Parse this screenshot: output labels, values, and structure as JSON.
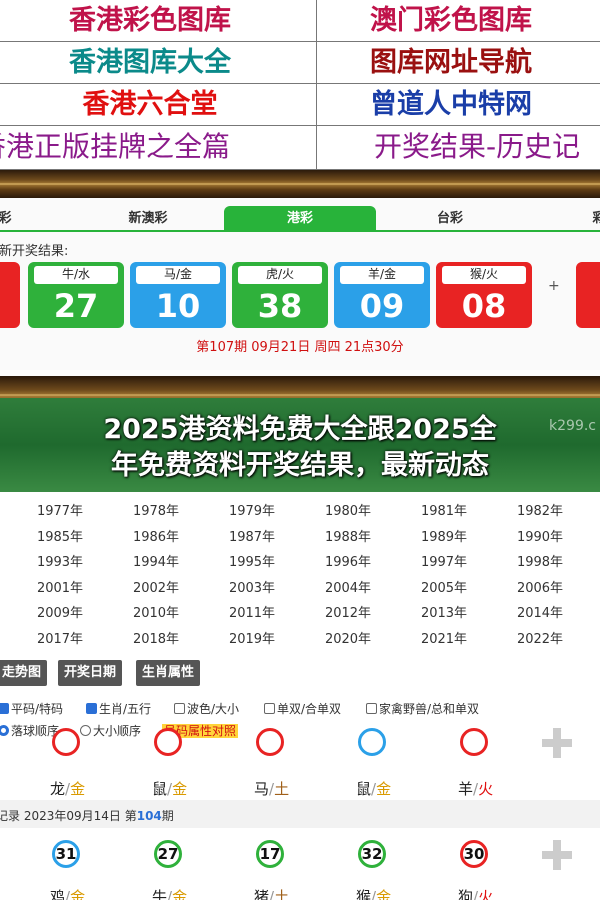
{
  "links": {
    "rows": [
      {
        "left": "香港彩色图库",
        "right": "澳门彩色图库",
        "left_color": "#c0134a",
        "right_color": "#c0134a"
      },
      {
        "left": "香港图库大全",
        "right": "图库网址导航",
        "left_color": "#0b8a8a",
        "right_color": "#9a1010"
      },
      {
        "left": "香港六合堂",
        "right": "曾道人中特网",
        "left_color": "#e01010",
        "right_color": "#1a3ea8"
      },
      {
        "left": "香港正版挂牌之全篇",
        "right": "开奖结果-历史记",
        "left_color": "#8a1a8a",
        "right_color": "#8a1a8a"
      }
    ]
  },
  "tabs": [
    "彩",
    "新澳彩",
    "港彩",
    "台彩",
    "彩"
  ],
  "active_tab": 2,
  "latest_label": "最新开奖结果:",
  "balls": [
    {
      "zodiac": "牛/水",
      "number": "27",
      "color": "#2fb13b"
    },
    {
      "zodiac": "马/金",
      "number": "10",
      "color": "#2ba0e8"
    },
    {
      "zodiac": "虎/火",
      "number": "38",
      "color": "#2fb13b"
    },
    {
      "zodiac": "羊/金",
      "number": "09",
      "color": "#2ba0e8"
    },
    {
      "zodiac": "猴/火",
      "number": "08",
      "color": "#e82323"
    }
  ],
  "plus": "+",
  "draw_info": "第107期 09月21日 周四 21点30分",
  "banner": {
    "line1": "2025港资料免费大全跟2025全",
    "line2": "年免费资料开奖结果，最新动态",
    "watermark": "k299.c"
  },
  "years": [
    [
      "1977年",
      "1978年",
      "1979年",
      "1980年",
      "1981年",
      "1982年"
    ],
    [
      "1985年",
      "1986年",
      "1987年",
      "1988年",
      "1989年",
      "1990年"
    ],
    [
      "1993年",
      "1994年",
      "1995年",
      "1996年",
      "1997年",
      "1998年"
    ],
    [
      "2001年",
      "2002年",
      "2003年",
      "2004年",
      "2005年",
      "2006年"
    ],
    [
      "2009年",
      "2010年",
      "2011年",
      "2012年",
      "2013年",
      "2014年"
    ],
    [
      "2017年",
      "2018年",
      "2019年",
      "2020年",
      "2021年",
      "2022年"
    ]
  ],
  "buttons": [
    "走势图",
    "开奖日期",
    "生肖属性"
  ],
  "filters": {
    "row1": [
      {
        "label": "平码/特码",
        "checked": true
      },
      {
        "label": "生肖/五行",
        "checked": true
      },
      {
        "label": "波色/大小",
        "checked": false
      },
      {
        "label": "单双/合单双",
        "checked": false
      },
      {
        "label": "家禽野兽/总和单双",
        "checked": false
      }
    ],
    "row2": [
      {
        "label": "落球顺序",
        "checked": true
      },
      {
        "label": "大小顺序",
        "checked": false
      }
    ],
    "highlight": "号码属性对照"
  },
  "history": {
    "row1_zodiac": [
      {
        "z": "龙",
        "e": "金",
        "ec": "#d99a00"
      },
      {
        "z": "鼠",
        "e": "金",
        "ec": "#d99a00"
      },
      {
        "z": "马",
        "e": "土",
        "ec": "#a0601a"
      },
      {
        "z": "鼠",
        "e": "金",
        "ec": "#d99a00"
      },
      {
        "z": "羊",
        "e": "火",
        "ec": "#e01010"
      }
    ],
    "row1_colors": [
      "#e82323",
      "#e82323",
      "#e82323",
      "#2ba0e8",
      "#e82323"
    ],
    "record_prefix": "记录 2023年09月14日 第",
    "record_issue": "104",
    "record_suffix": "期",
    "row2_balls": [
      {
        "n": "31",
        "c": "#2ba0e8"
      },
      {
        "n": "27",
        "c": "#2fb13b"
      },
      {
        "n": "17",
        "c": "#2fb13b"
      },
      {
        "n": "32",
        "c": "#2fb13b"
      },
      {
        "n": "30",
        "c": "#e82323"
      }
    ],
    "row2_zodiac": [
      {
        "z": "鸡",
        "e": "金",
        "ec": "#d99a00"
      },
      {
        "z": "牛",
        "e": "金",
        "ec": "#d99a00"
      },
      {
        "z": "猪",
        "e": "土",
        "ec": "#a0601a"
      },
      {
        "z": "猴",
        "e": "金",
        "ec": "#d99a00"
      },
      {
        "z": "狗",
        "e": "火",
        "ec": "#e01010"
      }
    ]
  }
}
